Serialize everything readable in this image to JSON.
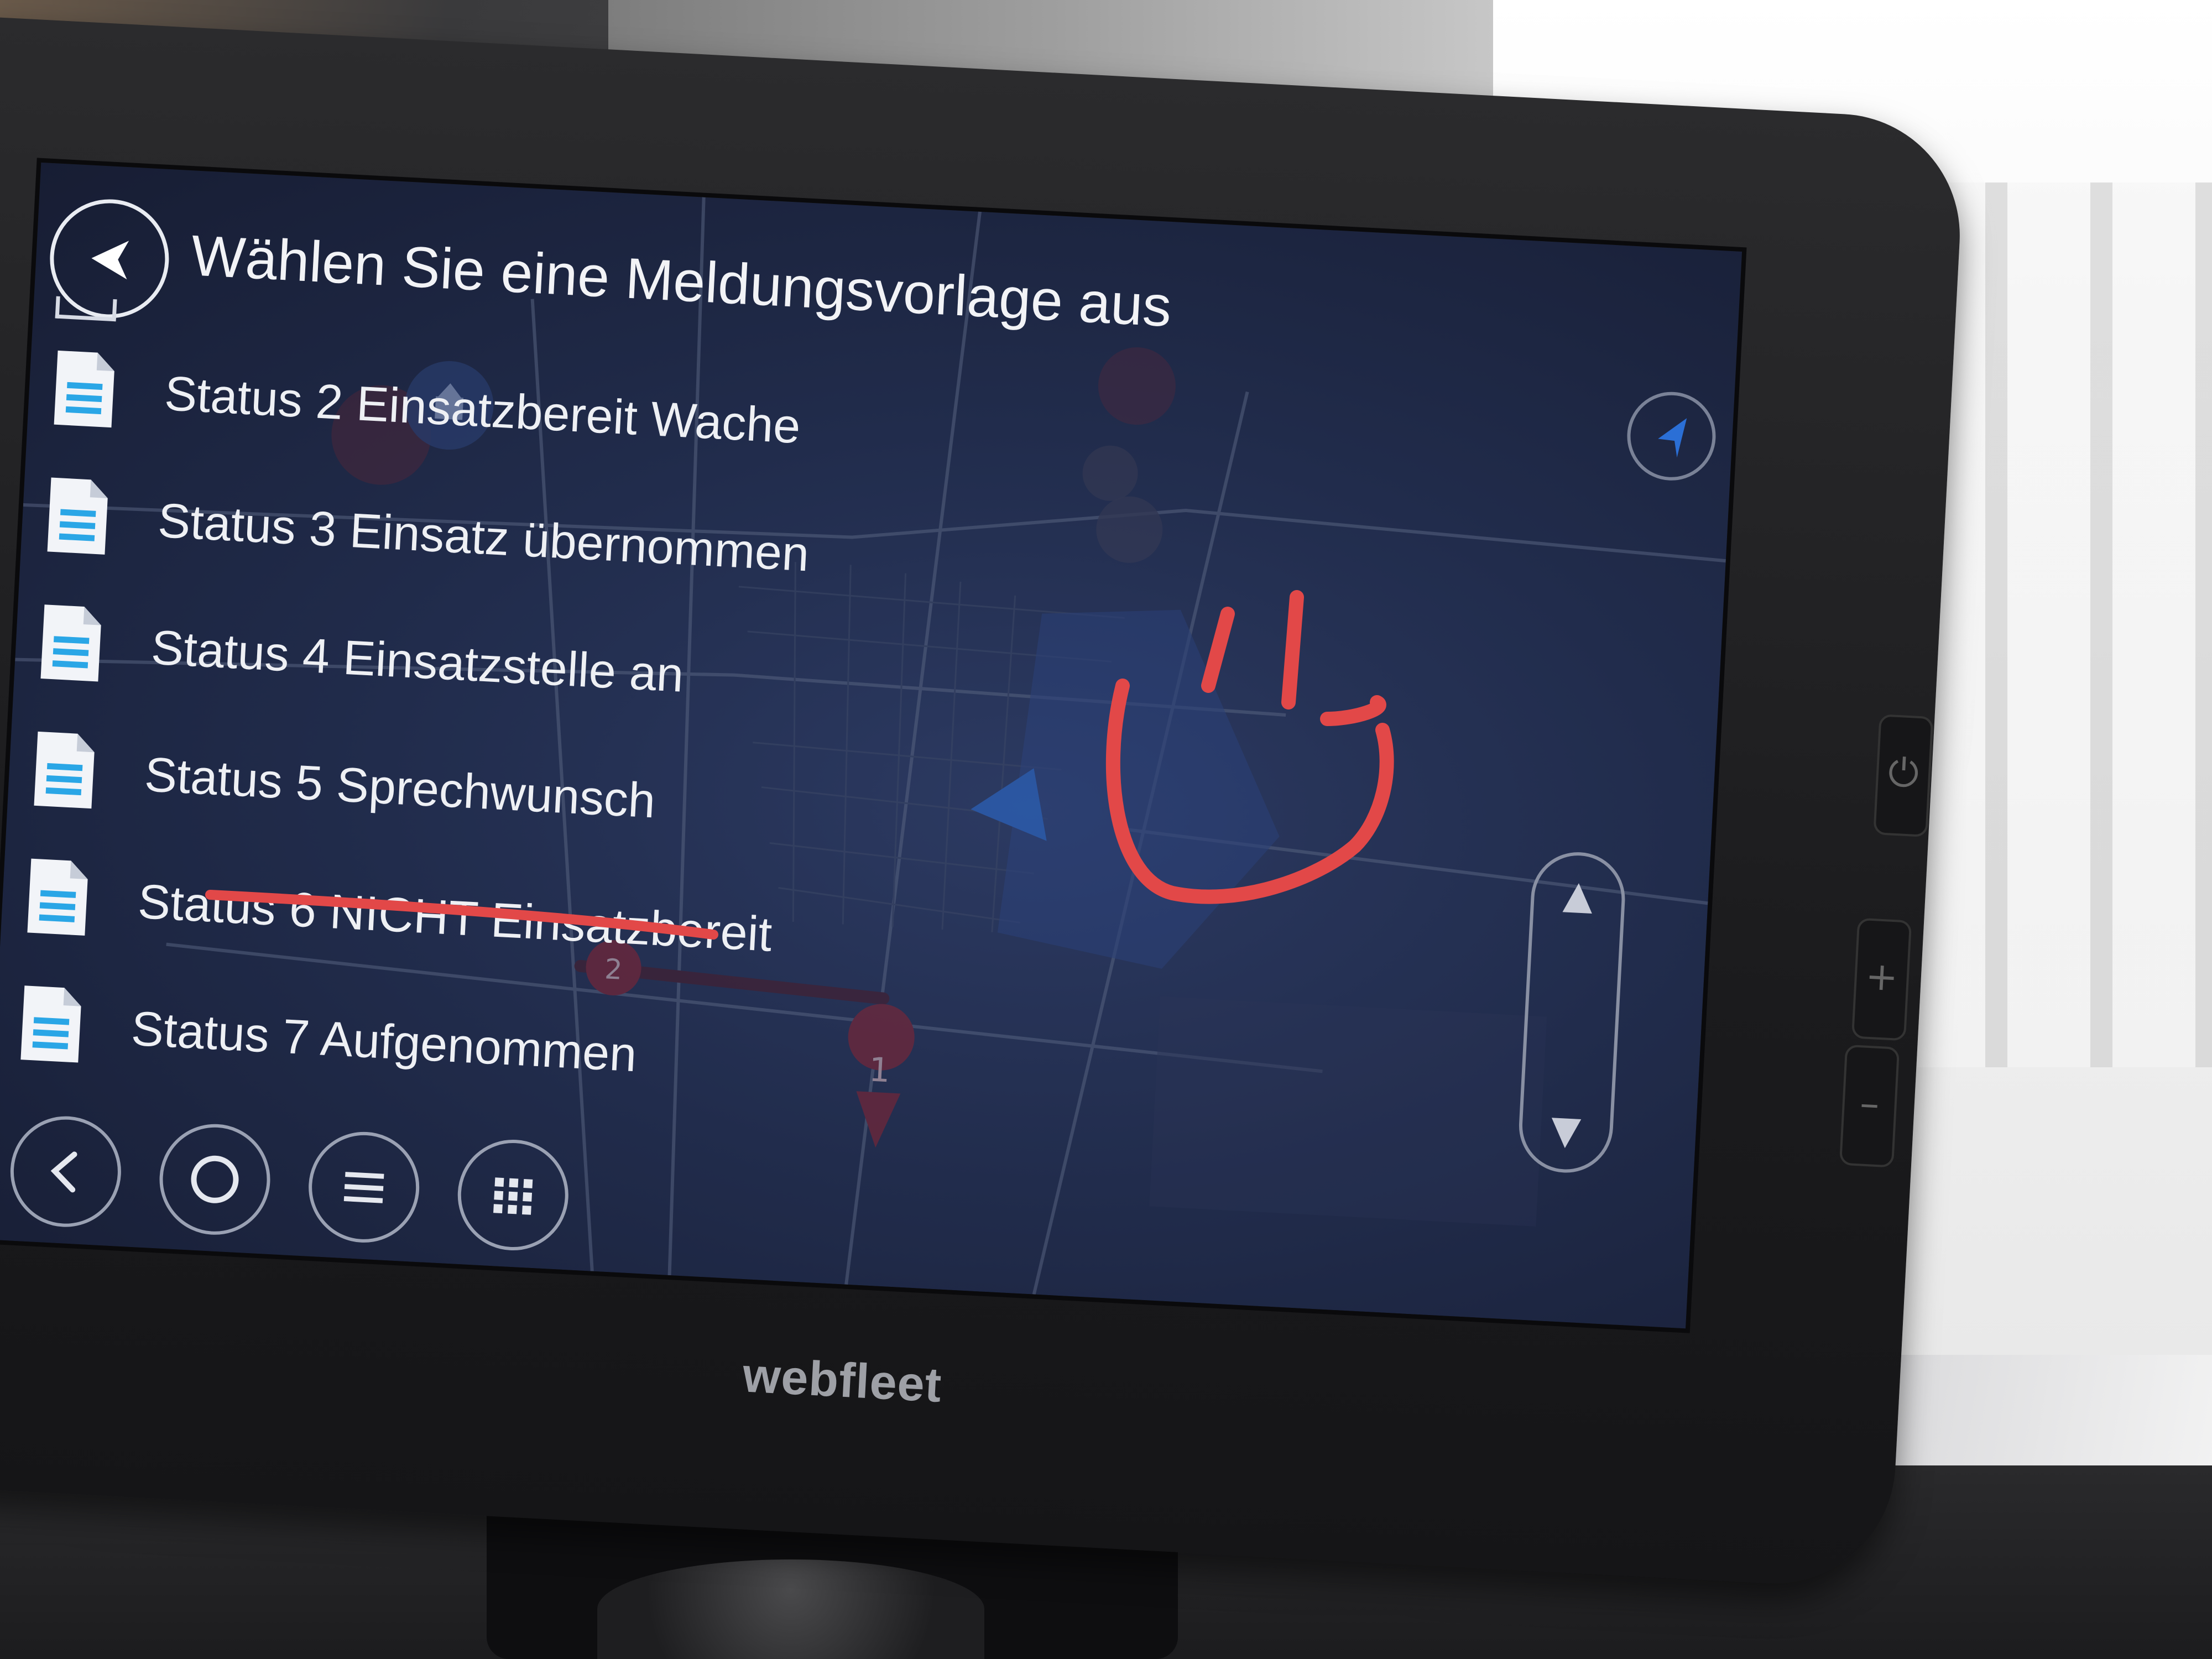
{
  "header": {
    "title": "Wählen Sie eine Meldungsvorlage aus"
  },
  "message_templates": [
    {
      "label": "Status 2 Einsatzbereit Wache"
    },
    {
      "label": "Status 3 Einsatz übernommen"
    },
    {
      "label": "Status 4 Einsatzstelle an"
    },
    {
      "label": "Status 5 Sprechwunsch"
    },
    {
      "label": "Status 6 NICHT Einsatzbereit"
    },
    {
      "label": "Status 7 Aufgenommen"
    }
  ],
  "map_markers": {
    "route_marker_1": "1",
    "route_marker_2": "2"
  },
  "bottom_nav": {
    "back_icon": "chevron-left-icon",
    "home_icon": "circle-icon",
    "menu_icon": "hamburger-icon",
    "apps_icon": "grid-icon"
  },
  "device": {
    "brand_logo": "webfleet"
  },
  "colors": {
    "doc_icon_lines": "#2aa6e6",
    "annotation_red": "#e24848",
    "position_arrow": "#2b6fd6",
    "screen_bg": "#212c4c"
  }
}
